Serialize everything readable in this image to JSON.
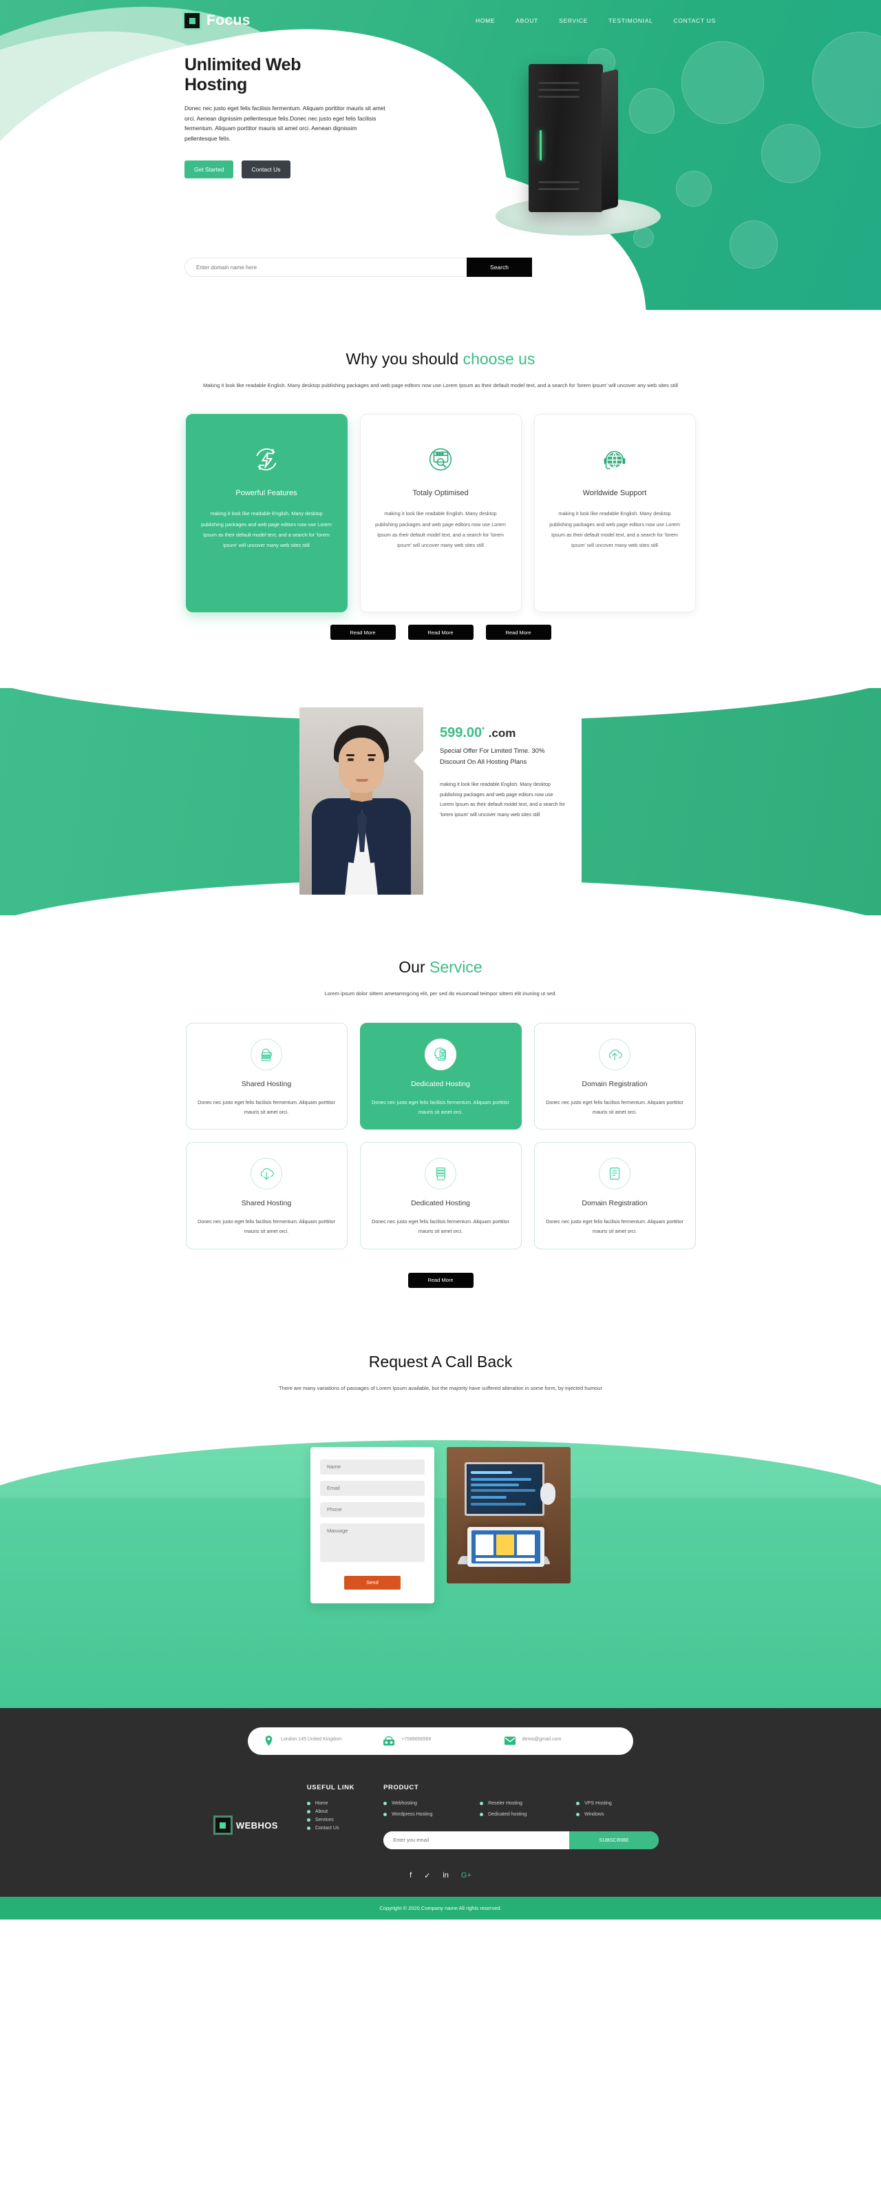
{
  "header": {
    "logo_text": "Focus",
    "logo_icon": "square-logo-icon",
    "nav": [
      {
        "label": "HOME",
        "active": true
      },
      {
        "label": "ABOUT",
        "active": false
      },
      {
        "label": "SERVICE",
        "active": false
      },
      {
        "label": "TESTIMONIAL",
        "active": false
      },
      {
        "label": "CONTACT US",
        "active": false
      }
    ]
  },
  "hero": {
    "title": "Unlimited Web Hosting",
    "paragraph": "Donec nec justo eget felis facilisis fermentum. Aliquam porttitor mauris sit amet orci. Aenean dignissim pellentesque felis.Donec nec justo eget felis facilisis fermentum. Aliquam porttitor mauris sit amet orci. Aenean dignissim pellentesque felis.",
    "btn_primary": "Get Started",
    "btn_secondary": "Contact Us",
    "search_placeholder": "Enter domain name here",
    "search_button": "Search"
  },
  "why": {
    "title_plain": "Why you should ",
    "title_accent": "choose us",
    "subtitle": "Making it look like readable English. Many desktop publishing packages and web page editors now use Lorem Ipsum as their default model text, and a search for 'lorem ipsum' will uncover any web sites still",
    "body_text": "making it look like readable English. Many desktop publishing packages and web page editors now use Lorem Ipsum as their default model text, and a search for 'lorem ipsum' will uncover many web sites still",
    "cards": [
      {
        "title": "Powerful Features",
        "icon": "power-refresh-icon",
        "active": true
      },
      {
        "title": "Totaly Optimised",
        "icon": "browser-search-icon",
        "active": false
      },
      {
        "title": "Worldwide Support",
        "icon": "globe-headset-icon",
        "active": false
      }
    ],
    "read_more": "Read More"
  },
  "offer": {
    "price": "599.00",
    "price_sup": "*",
    "domain": ".com",
    "headline": "Special Offer For Limited Time. 30% Discount On All Hosting Plans",
    "paragraph": "making it look like readable English. Many desktop publishing packages and web page editors now use Lorem Ipsum as their default model text, and a search for 'lorem ipsum' will uncover many web sites still"
  },
  "service": {
    "title_plain": "Our ",
    "title_accent": "Service",
    "subtitle": "Lorem ipsum dolor sittem ametamngcing elit, per sed do eiusmoad teimpor sittem elit inuning ut sed.",
    "card_text": "Donec nec justo eget felis facilisis fermentum. Aliquam porttitor mauris sit amet orci.",
    "cards": [
      {
        "title": "Shared Hosting",
        "icon": "cloud-server-icon",
        "active": false
      },
      {
        "title": "Dedicated Hosting",
        "icon": "head-server-icon",
        "active": true
      },
      {
        "title": "Domain Registration",
        "icon": "cloud-upload-icon",
        "active": false
      },
      {
        "title": "Shared Hosting",
        "icon": "cloud-download-icon",
        "active": false
      },
      {
        "title": "Dedicated Hosting",
        "icon": "server-cloud-icon",
        "active": false
      },
      {
        "title": "Domain Registration",
        "icon": "document-list-icon",
        "active": false
      }
    ],
    "read_more": "Read More"
  },
  "callback": {
    "title": "Request A Call Back",
    "subtitle": "There are many variations of passages of Lorem Ipsum available, but the majority have suffered alteration in some form, by injected humour",
    "form": {
      "name_placeholder": "Name",
      "email_placeholder": "Email",
      "phone_placeholder": "Phone",
      "message_placeholder": "Massage",
      "send_label": "Send"
    }
  },
  "footer": {
    "contacts": [
      {
        "icon": "location-pin-icon",
        "text": "London 145 United Kingdom"
      },
      {
        "icon": "telephone-icon",
        "text": "+7586656566"
      },
      {
        "icon": "envelope-icon",
        "text": "demo@gmail.com"
      }
    ],
    "logo_text": "WEBHOS",
    "useful_link_title": "USEFUL LINK",
    "useful_links": [
      "Home",
      "About",
      "Services",
      "Contact Us"
    ],
    "product_title": "PRODUCT",
    "products": [
      "Webhosting",
      "Reseler Hosting",
      "VPS Hosting",
      "Wordpress Hosting",
      "Dedicated hosting",
      "Windows"
    ],
    "newsletter_placeholder": "Enter you email",
    "subscribe_label": "SUBSCRIBE",
    "social": [
      {
        "name": "facebook-icon",
        "glyph": "f"
      },
      {
        "name": "twitter-icon",
        "glyph": "✓"
      },
      {
        "name": "linkedin-icon",
        "glyph": "in"
      },
      {
        "name": "google-plus-icon",
        "glyph": "G+"
      }
    ],
    "copyright": "Copyright © 2020.Company name All rights reserved."
  },
  "colors": {
    "brand_green": "#3cbc86",
    "dark": "#2e2e2e",
    "accent_orange": "#d9531e",
    "copyright_bar": "#27b075"
  }
}
